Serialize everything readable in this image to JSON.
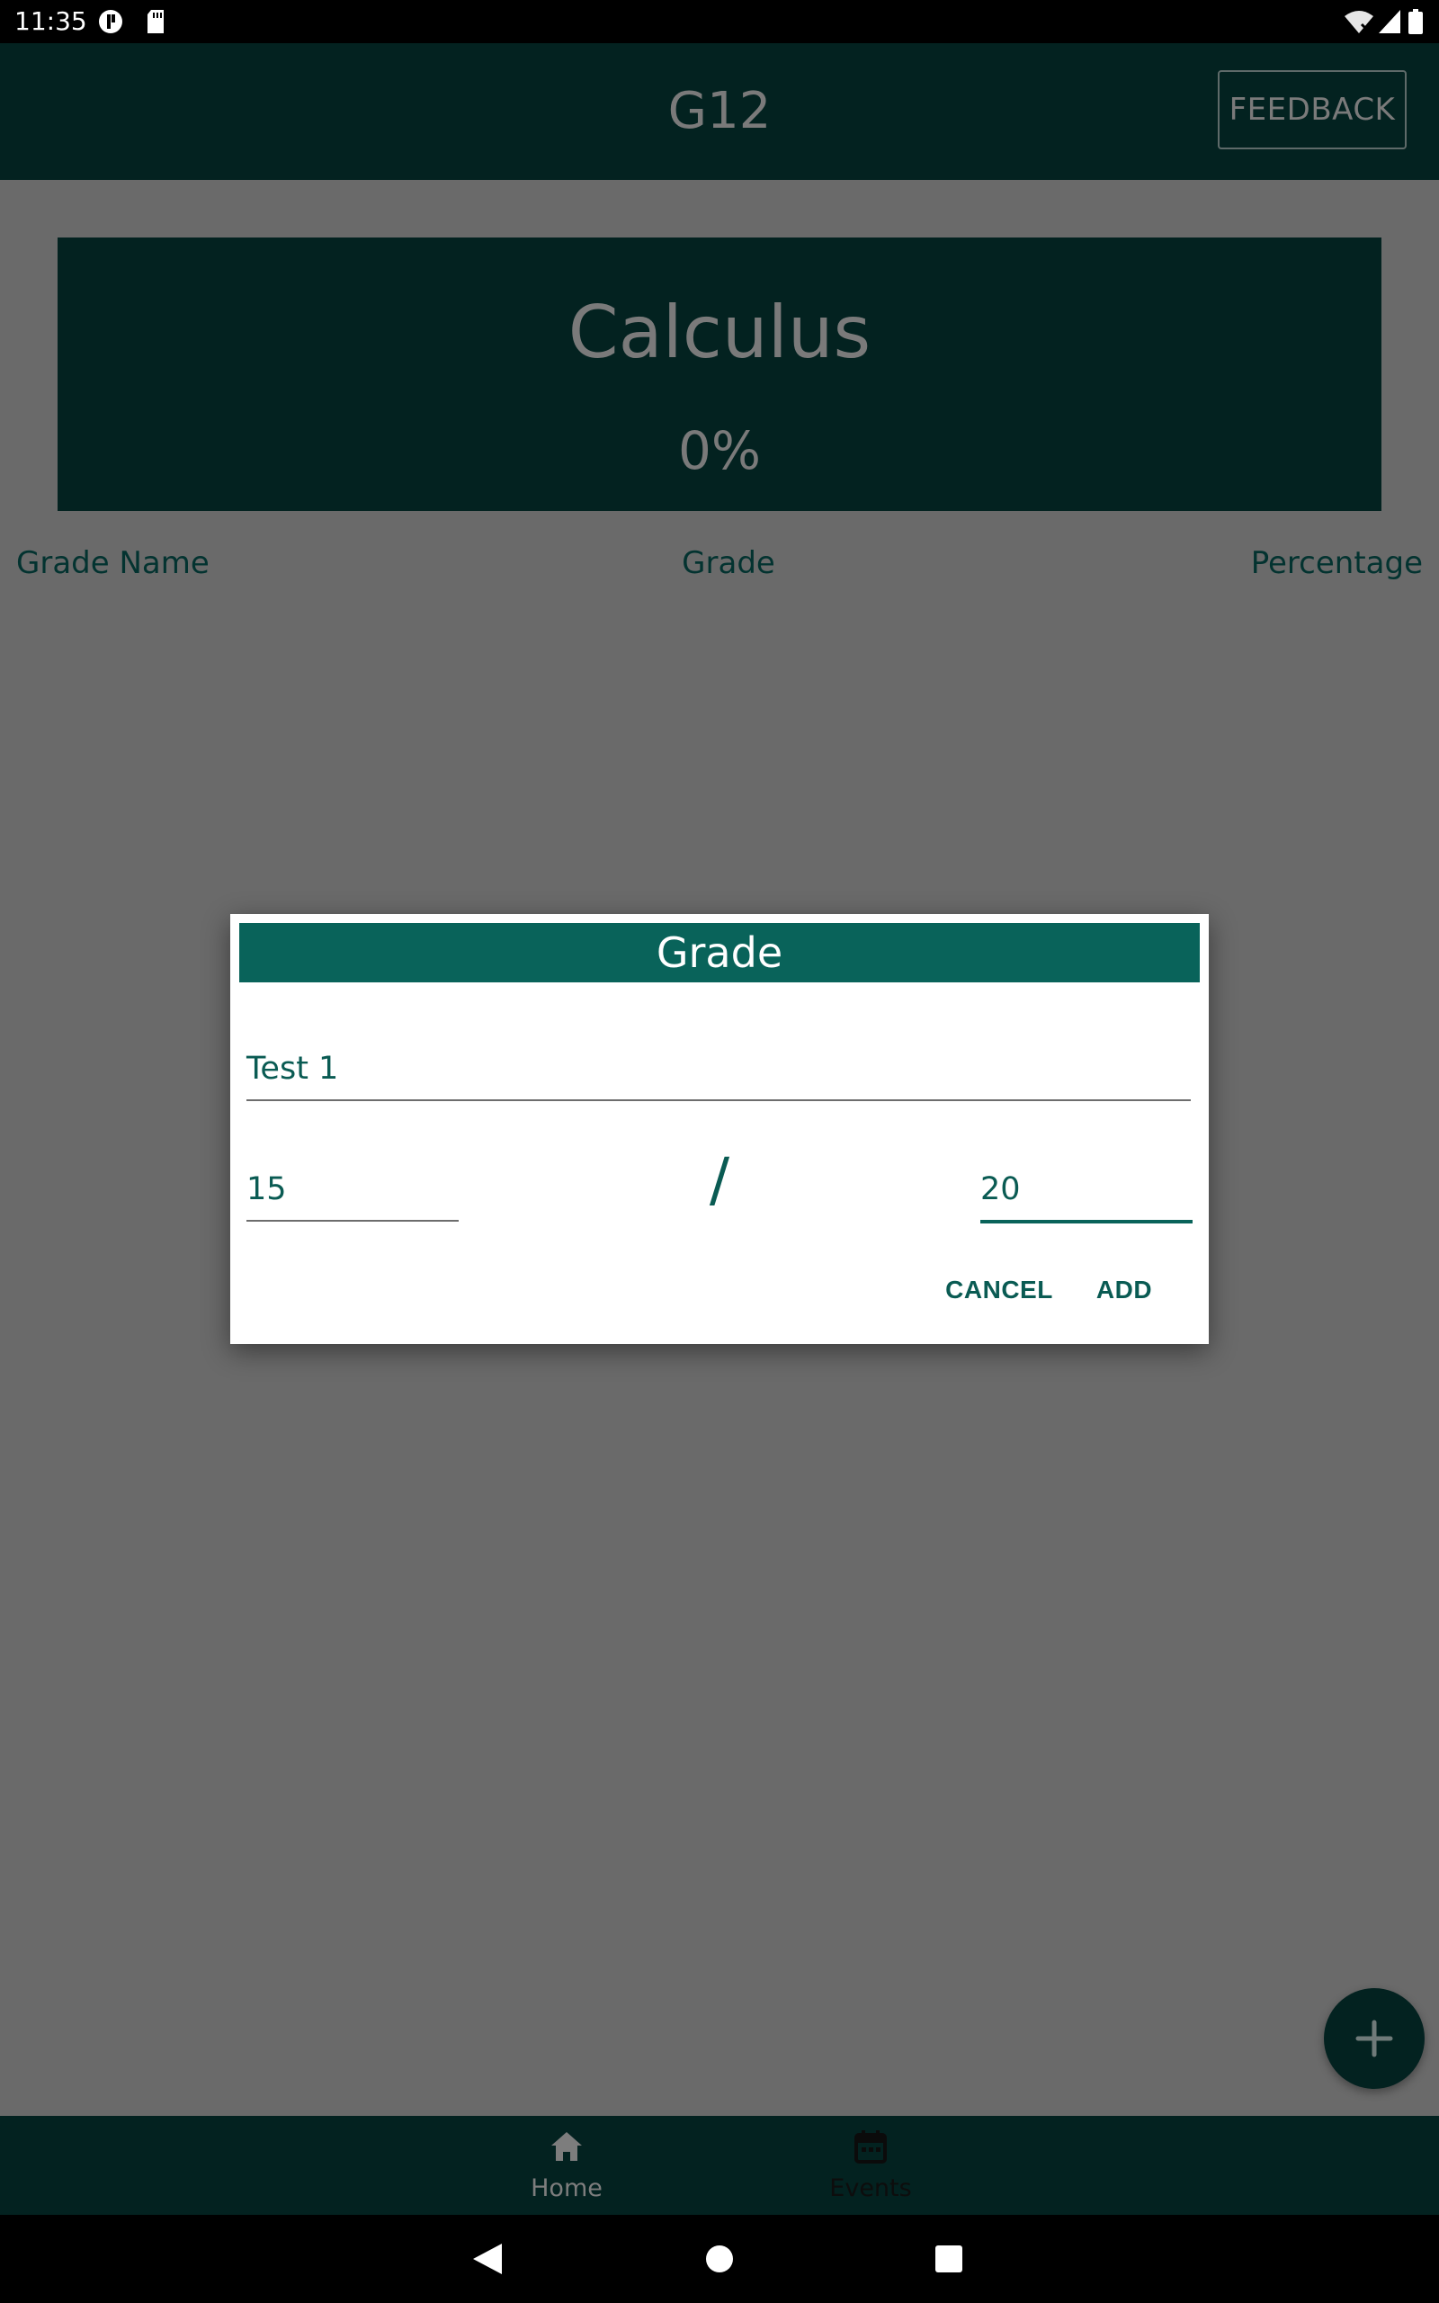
{
  "status_bar": {
    "time": "11:35"
  },
  "app_bar": {
    "title": "G12",
    "feedback_label": "FEEDBACK"
  },
  "course": {
    "name": "Calculus",
    "percentage": "0%"
  },
  "columns": {
    "grade_name": "Grade Name",
    "grade": "Grade",
    "percentage": "Percentage"
  },
  "bottom_nav": [
    {
      "label": "Home",
      "icon": "home-icon"
    },
    {
      "label": "Events",
      "icon": "calendar-icon"
    }
  ],
  "dialog": {
    "title": "Grade",
    "name_value": "Test 1",
    "score_value": "15",
    "separator": "/",
    "total_value": "20",
    "cancel_label": "CANCEL",
    "add_label": "ADD"
  },
  "colors": {
    "primary_dark": "#032220",
    "dialog_header": "#09635a",
    "accent_text": "#0a5b53",
    "scrim": "#6a6a6a"
  }
}
